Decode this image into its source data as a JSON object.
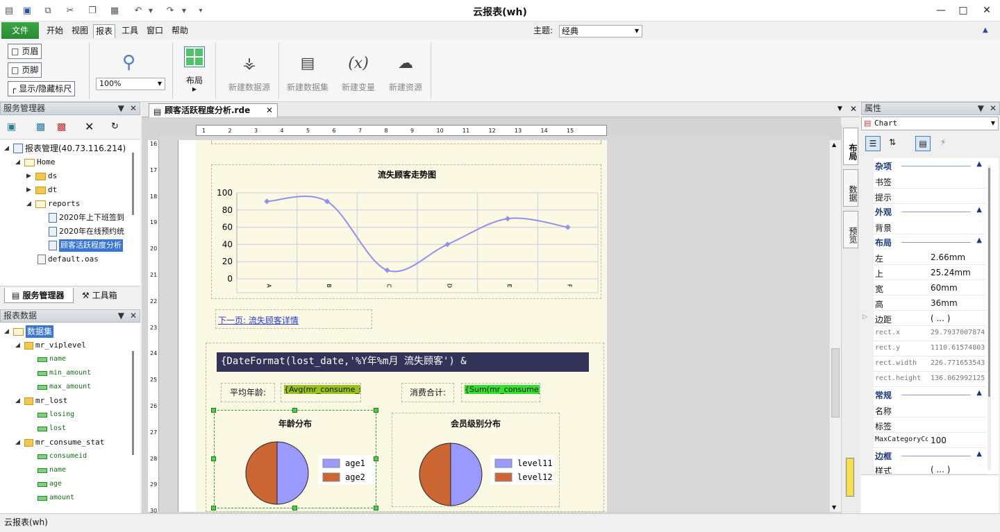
{
  "app": {
    "title": "云报表(wh)",
    "status": "云报表(wh)"
  },
  "menu": {
    "file": "文件",
    "items": [
      "开始",
      "视图",
      "报表",
      "工具",
      "窗口",
      "帮助"
    ],
    "theme_label": "主题:",
    "theme_value": "经典"
  },
  "ribbon": {
    "header": "页眉",
    "footer": "页脚",
    "ruler": "显示/隐藏标尺",
    "zoom": "100%",
    "layout": "布局",
    "new_datasource": "新建数据源",
    "new_dataset": "新建数据集",
    "new_variable": "新建变量",
    "new_resource": "新建资源"
  },
  "server_panel": {
    "title": "服务管理器",
    "tree": {
      "root": "报表管理(40.73.116.214)",
      "home": "Home",
      "ds": "ds",
      "dt": "dt",
      "reports": "reports",
      "r1": "2020年上下班签到",
      "r2": "2020年在线预约统",
      "r3": "顾客活跃程度分析",
      "default": "default.oas"
    },
    "tabs": [
      "服务管理器",
      "工具箱"
    ]
  },
  "data_panel": {
    "title": "报表数据",
    "root": "数据集",
    "sets": [
      {
        "name": "mr_viplevel",
        "fields": [
          "name",
          "min_amount",
          "max_amount"
        ]
      },
      {
        "name": "mr_lost",
        "fields": [
          "losing",
          "lost"
        ]
      },
      {
        "name": "mr_consume_stat",
        "fields": [
          "consumeid",
          "name",
          "age",
          "amount"
        ]
      }
    ]
  },
  "doc": {
    "tab": "顾客活跃程度分析.rde",
    "ruler_top": [
      "1",
      "2",
      "3",
      "4",
      "5",
      "6",
      "7",
      "8",
      "9",
      "10",
      "11",
      "12",
      "13",
      "14",
      "15"
    ],
    "ruler_left": [
      "16",
      "17",
      "18",
      "19",
      "20",
      "21",
      "22",
      "23",
      "24",
      "25",
      "26",
      "27",
      "28",
      "29",
      "30"
    ]
  },
  "report": {
    "line_chart_title": "流失顾客走势图",
    "link": "下一页: 流失顾客详情",
    "header_expr": "{DateFormat(lost_date,'%Y年%m月 流失顾客') &",
    "avg_label": "平均年龄:",
    "avg_expr": "{Avg(mr_consume_stat['age'])}",
    "sum_label": "消费合计:",
    "sum_expr": "{Sum(mr_consume_stat['consume",
    "pie1_title": "年龄分布",
    "pie2_title": "会员级别分布"
  },
  "chart_data": [
    {
      "type": "line",
      "title": "流失顾客走势图",
      "categories": [
        "A",
        "B",
        "C",
        "D",
        "E",
        "F"
      ],
      "series": [
        {
          "values": [
            90,
            90,
            10,
            40,
            70,
            60
          ]
        }
      ],
      "ylim": [
        0,
        100
      ],
      "yticks": [
        "0",
        "20",
        "40",
        "60",
        "80",
        "100"
      ],
      "color": "#9090ee",
      "grid": true
    },
    {
      "type": "pie",
      "title": "年龄分布",
      "slices": [
        {
          "label": "age1",
          "value": 50,
          "color": "#9999ff"
        },
        {
          "label": "age2",
          "value": 50,
          "color": "#cc6633"
        }
      ]
    },
    {
      "type": "pie",
      "title": "会员级别分布",
      "slices": [
        {
          "label": "level11",
          "value": 50,
          "color": "#9999ff"
        },
        {
          "label": "level12",
          "value": 50,
          "color": "#cc6633"
        }
      ]
    }
  ],
  "properties": {
    "title": "属性",
    "object": "Chart",
    "cats": {
      "misc": "杂项",
      "appearance": "外观",
      "layout": "布局",
      "general": "常规",
      "border": "边框"
    },
    "rows": {
      "bookmark": "书签",
      "tooltip": "提示",
      "background": "背景",
      "left": "左",
      "left_v": "2.66mm",
      "top": "上",
      "top_v": "25.24mm",
      "width": "宽",
      "width_v": "60mm",
      "height": "高",
      "height_v": "36mm",
      "margin": "边距",
      "margin_v": "( ... )",
      "rx": "rect.x",
      "rx_v": "29.7937007874",
      "ry": "rect.y",
      "ry_v": "1110.61574803",
      "rw": "rect.width",
      "rw_v": "226.771653543",
      "rh": "rect.height",
      "rh_v": "136.062992125",
      "name": "名称",
      "label": "标签",
      "maxcat": "MaxCategoryCo",
      "maxcat_v": "100",
      "style": "样式",
      "style_v": "( ... )"
    },
    "side_tabs": [
      "布局",
      "数据",
      "预览"
    ]
  }
}
